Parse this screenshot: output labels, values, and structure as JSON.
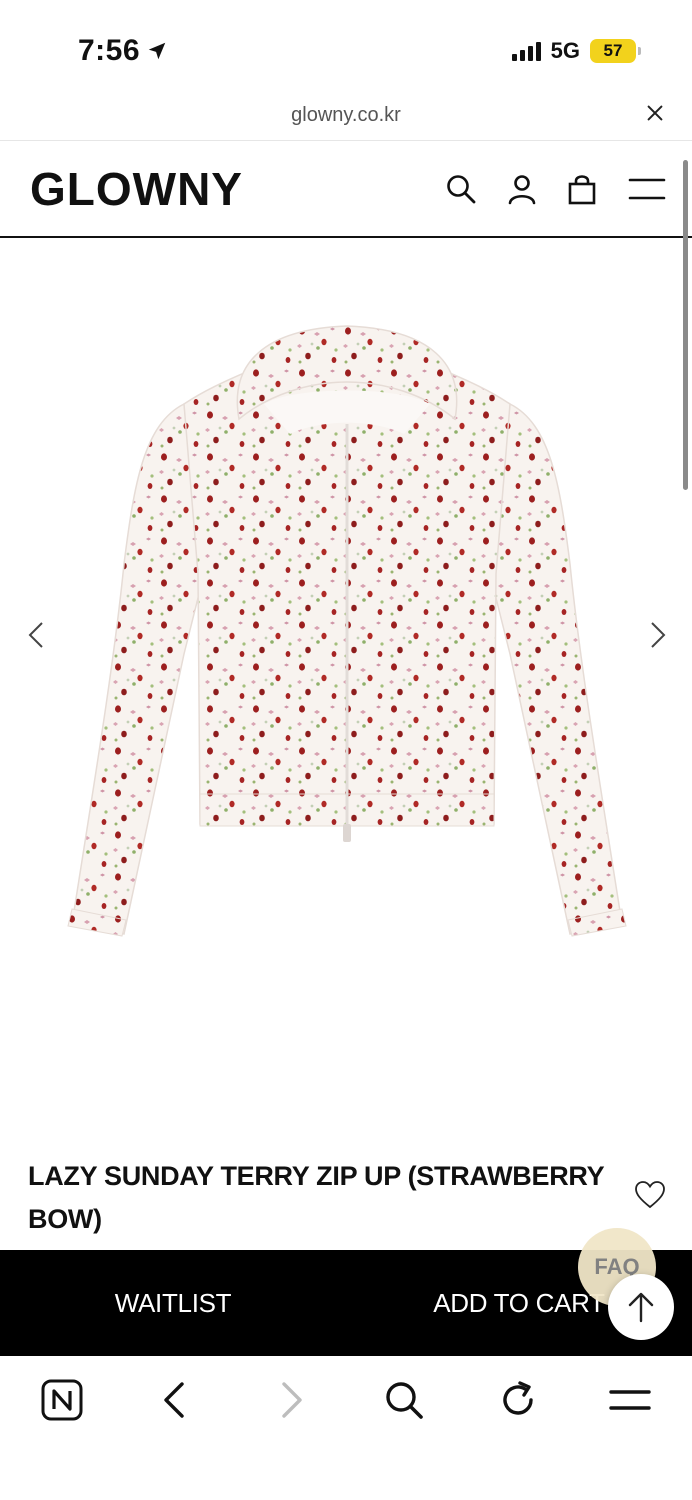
{
  "status_bar": {
    "time": "7:56",
    "network": "5G",
    "battery": "57"
  },
  "browser": {
    "url": "glowny.co.kr"
  },
  "header": {
    "logo": "GLOWNY",
    "icons": [
      "search-icon",
      "user-icon",
      "bag-icon",
      "menu-icon"
    ]
  },
  "product": {
    "title": "LAZY SUNDAY TERRY ZIP UP (STRAWBERRY BOW)",
    "image_alt": "hoodie-image"
  },
  "actions": {
    "waitlist_label": "WAITLIST",
    "add_to_cart_label": "ADD TO CART",
    "faq_label": "FAQ"
  },
  "colors": {
    "action_bar": "#000000",
    "battery": "#f2d21c",
    "faq_bubble": "#f1e6c8"
  },
  "toolbar": {
    "icons": [
      "naver-icon",
      "back-icon",
      "forward-icon",
      "search-icon",
      "reload-icon",
      "menu-icon"
    ]
  }
}
